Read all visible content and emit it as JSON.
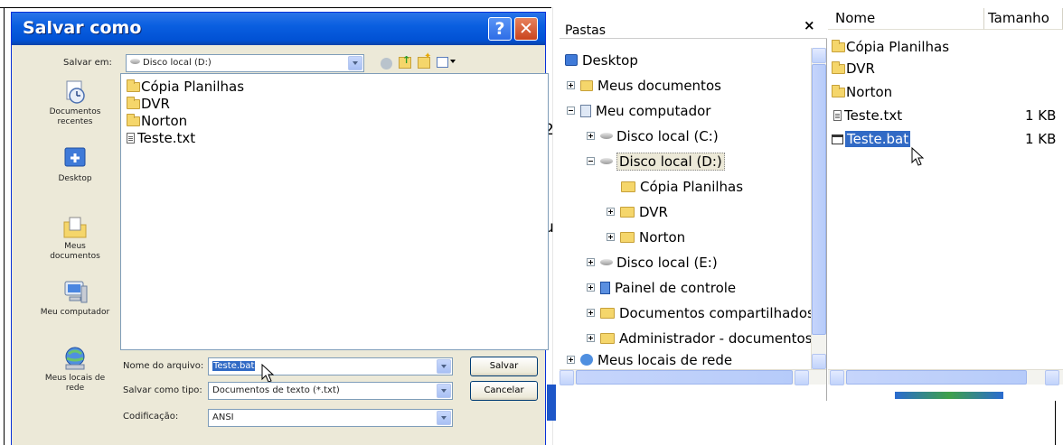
{
  "save_dialog": {
    "title": "Salvar como",
    "save_in_label": "Salvar em:",
    "save_in_value": "Disco local (D:)",
    "places": [
      {
        "label": "Documentos recentes",
        "icon": "recent-documents-icon"
      },
      {
        "label": "Desktop",
        "icon": "desktop-icon"
      },
      {
        "label": "Meus documentos",
        "icon": "my-documents-icon"
      },
      {
        "label": "Meu computador",
        "icon": "my-computer-icon"
      },
      {
        "label": "Meus locais de rede",
        "icon": "network-places-icon"
      }
    ],
    "files": [
      {
        "name": "Cópia Planilhas",
        "type": "folder"
      },
      {
        "name": "DVR",
        "type": "folder"
      },
      {
        "name": "Norton",
        "type": "folder"
      },
      {
        "name": "Teste.txt",
        "type": "text"
      }
    ],
    "filename_label": "Nome do arquivo:",
    "filename_value": "Teste.bat",
    "filetype_label": "Salvar como tipo:",
    "filetype_value": "Documentos de texto (*.txt)",
    "encoding_label": "Codificação:",
    "encoding_value": "ANSI",
    "save_button": "Salvar",
    "cancel_button": "Cancelar"
  },
  "explorer": {
    "folders_header": "Pastas",
    "close_glyph": "×",
    "tree": [
      {
        "label": "Desktop",
        "expander": "none"
      },
      {
        "label": "Meus documentos",
        "expander": "plus"
      },
      {
        "label": "Meu computador",
        "expander": "minus"
      },
      {
        "label": "Disco local (C:)",
        "expander": "plus"
      },
      {
        "label": "Disco local (D:)",
        "expander": "minus"
      },
      {
        "label": "Cópia Planilhas",
        "expander": "none"
      },
      {
        "label": "DVR",
        "expander": "plus"
      },
      {
        "label": "Norton",
        "expander": "plus"
      },
      {
        "label": "Disco local (E:)",
        "expander": "plus"
      },
      {
        "label": "Painel de controle",
        "expander": "plus"
      },
      {
        "label": "Documentos compartilhados",
        "expander": "plus"
      },
      {
        "label": "Administrador - documentos",
        "expander": "plus"
      },
      {
        "label": "Meus locais de rede",
        "expander": "plus"
      }
    ],
    "columns": [
      "Nome",
      "Tamanho"
    ],
    "rows": [
      {
        "name": "Cópia Planilhas",
        "size": ""
      },
      {
        "name": "DVR",
        "size": ""
      },
      {
        "name": "Norton",
        "size": ""
      },
      {
        "name": "Teste.txt",
        "size": "1 KB"
      },
      {
        "name": "Teste.bat",
        "size": "1 KB"
      }
    ],
    "selection_color": "#316ac5"
  },
  "background_fragments": [
    "2",
    "u"
  ]
}
